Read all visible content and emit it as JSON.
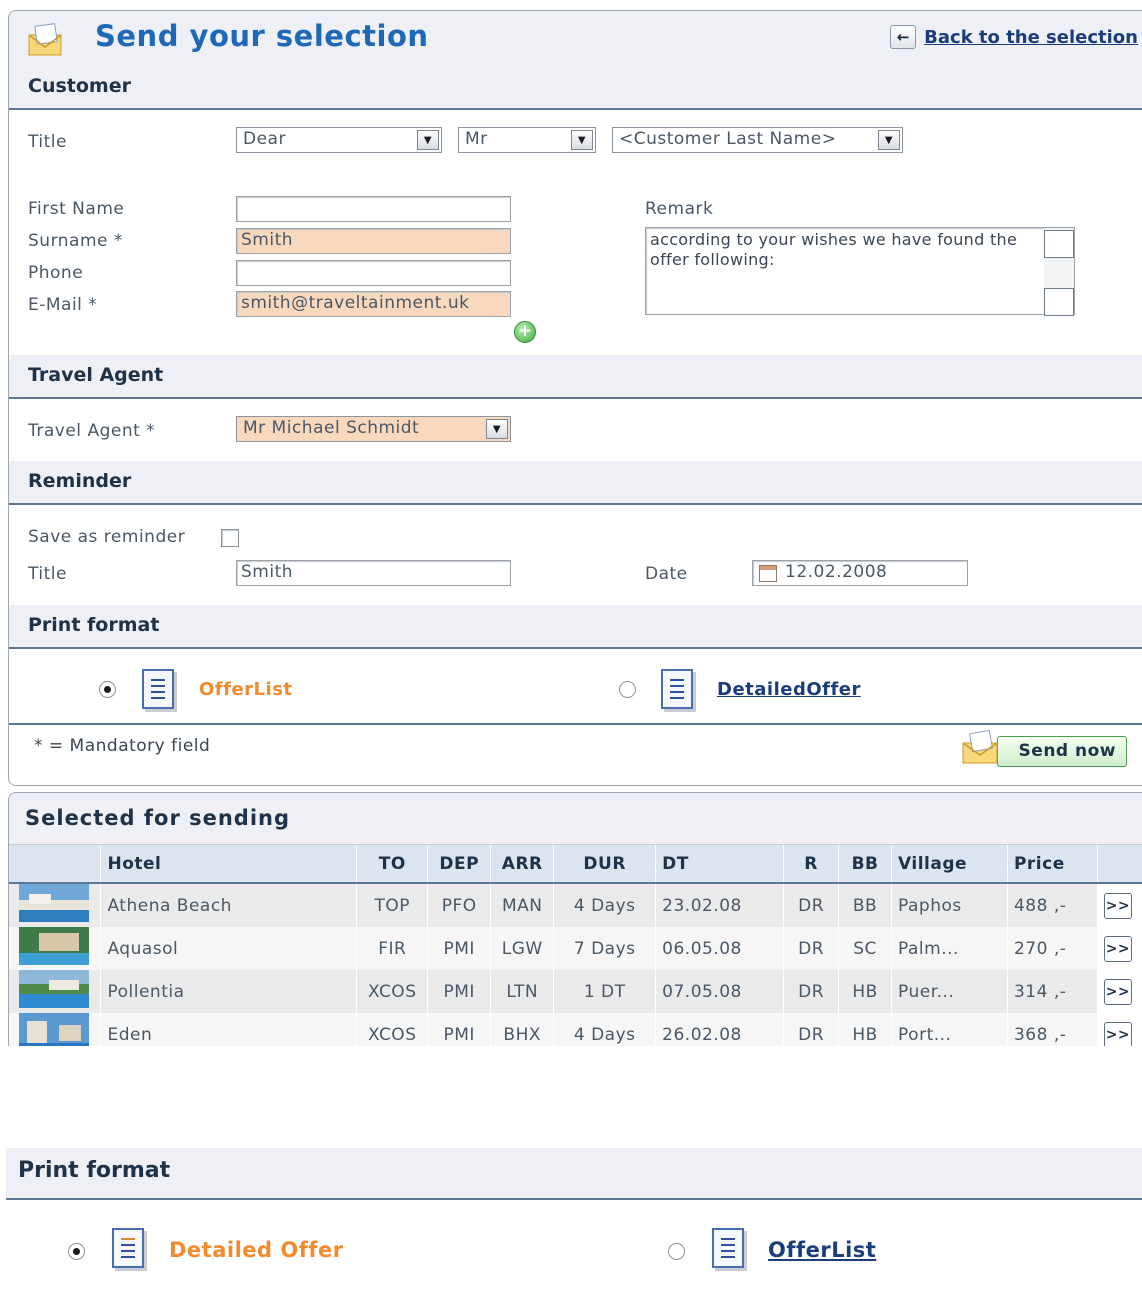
{
  "header": {
    "title": "Send your selection",
    "back_label": "Back to the selection"
  },
  "customer": {
    "section_title": "Customer",
    "title_label": "Title",
    "salutation": "Dear",
    "form_of_address": "Mr",
    "name_option": "<Customer Last Name>",
    "first_name_label": "First Name",
    "first_name_value": "",
    "surname_label": "Surname *",
    "surname_value": "Smith",
    "phone_label": "Phone",
    "phone_value": "",
    "email_label": "E-Mail *",
    "email_value": "smith@traveltainment.uk",
    "remark_label": "Remark",
    "remark_value": "according to your wishes we have found the offer following:"
  },
  "travel_agent": {
    "section_title": "Travel Agent",
    "label": "Travel Agent *",
    "value": "Mr Michael Schmidt"
  },
  "reminder": {
    "section_title": "Reminder",
    "save_label": "Save as reminder",
    "save_checked": false,
    "title_label": "Title",
    "title_value": "Smith",
    "date_label": "Date",
    "date_value": "12.02.2008"
  },
  "print_format": {
    "section_title": "Print format",
    "options": [
      {
        "label": "OfferList",
        "selected": true
      },
      {
        "label": "DetailedOffer",
        "selected": false
      }
    ]
  },
  "footer": {
    "mandatory_note": "* = Mandatory field",
    "send_label": "Send now"
  },
  "selected": {
    "section_title": "Selected for sending",
    "columns": [
      "Hotel",
      "TO",
      "DEP",
      "ARR",
      "DUR",
      "DT",
      "R",
      "BB",
      "Village",
      "Price"
    ],
    "rows": [
      {
        "hotel": "Athena Beach",
        "to": "TOP",
        "dep": "PFO",
        "arr": "MAN",
        "dur": "4 Days",
        "dt": "23.02.08",
        "r": "DR",
        "bb": "BB",
        "village": "Paphos",
        "price": "488 ,-"
      },
      {
        "hotel": "Aquasol",
        "to": "FIR",
        "dep": "PMI",
        "arr": "LGW",
        "dur": "7 Days",
        "dt": "06.05.08",
        "r": "DR",
        "bb": "SC",
        "village": "Palm...",
        "price": "270 ,-"
      },
      {
        "hotel": "Pollentia",
        "to": "XCOS",
        "dep": "PMI",
        "arr": "LTN",
        "dur": "1 DT",
        "dt": "07.05.08",
        "r": "DR",
        "bb": "HB",
        "village": "Puer...",
        "price": "314 ,-"
      },
      {
        "hotel": "Eden",
        "to": "XCOS",
        "dep": "PMI",
        "arr": "BHX",
        "dur": "4 Days",
        "dt": "26.02.08",
        "r": "DR",
        "bb": "HB",
        "village": "Port...",
        "price": "368 ,-"
      }
    ],
    "more_label": ">>"
  },
  "print_format_alt": {
    "section_title": "Print format",
    "options": [
      {
        "label": "Detailed Offer",
        "selected": true
      },
      {
        "label": "OfferList",
        "selected": false
      }
    ]
  },
  "colors": {
    "title_blue": "#1f68b8",
    "highlight_field": "#f9d9bd",
    "active_format": "#f28a2e",
    "link": "#1b3e7a"
  }
}
